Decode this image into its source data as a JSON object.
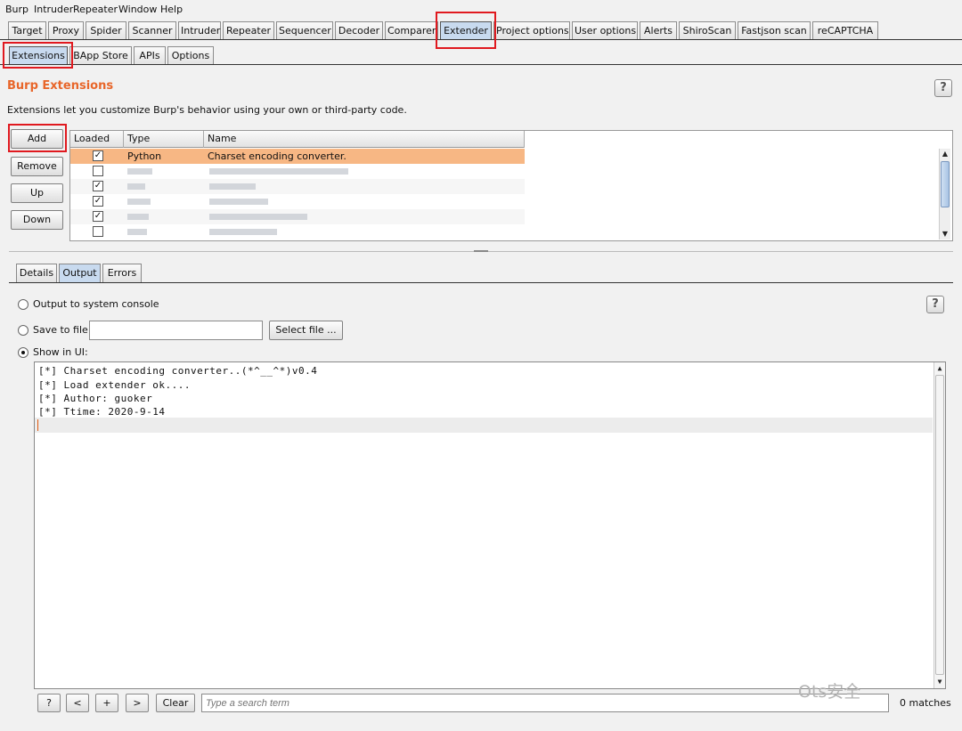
{
  "menu": [
    "Burp",
    "Intruder",
    "Repeater",
    "Window",
    "Help"
  ],
  "main_tabs": [
    "Target",
    "Proxy",
    "Spider",
    "Scanner",
    "Intruder",
    "Repeater",
    "Sequencer",
    "Decoder",
    "Comparer",
    "Extender",
    "Project options",
    "User options",
    "Alerts",
    "ShiroScan",
    "Fastjson scan",
    "reCAPTCHA"
  ],
  "selected_main_tab": "Extender",
  "sub_tabs": [
    "Extensions",
    "BApp Store",
    "APIs",
    "Options"
  ],
  "selected_sub_tab": "Extensions",
  "section": {
    "title": "Burp Extensions",
    "description": "Extensions let you customize Burp's behavior using your own or third-party code."
  },
  "help_label": "?",
  "side_buttons": {
    "add": "Add",
    "remove": "Remove",
    "up": "Up",
    "down": "Down"
  },
  "table": {
    "columns": [
      "Loaded",
      "Type",
      "Name"
    ],
    "rows": [
      {
        "loaded": true,
        "type": "Python",
        "name": "Charset encoding converter.",
        "selected": true
      },
      {
        "loaded": false,
        "type": "",
        "name": "",
        "selected": false
      },
      {
        "loaded": true,
        "type": "",
        "name": "",
        "selected": false
      },
      {
        "loaded": true,
        "type": "",
        "name": "",
        "selected": false
      },
      {
        "loaded": true,
        "type": "",
        "name": "",
        "selected": false
      },
      {
        "loaded": false,
        "type": "",
        "name": "",
        "selected": false
      }
    ]
  },
  "detail_tabs": [
    "Details",
    "Output",
    "Errors"
  ],
  "selected_detail_tab": "Output",
  "output_options": {
    "system_console": "Output to system console",
    "save_to_file": "Save to file:",
    "select_file_button": "Select file ...",
    "show_in_ui": "Show in UI:",
    "selected": "show_in_ui"
  },
  "output_lines": [
    "[*] Charset encoding converter..(*^__^*)v0.4",
    "[*] Load extender ok....",
    "[*] Author: guoker",
    "[*] Ttime: 2020-9-14"
  ],
  "search": {
    "buttons": [
      "?",
      "<",
      "+",
      ">"
    ],
    "clear": "Clear",
    "placeholder": "Type a search term",
    "matches": "0 matches"
  },
  "watermark": "Ots安全",
  "colors": {
    "accent_title": "#e8662a",
    "selected_row": "#f7b784",
    "selected_tab": "#c8daef",
    "highlight_box": "#e0191f"
  }
}
